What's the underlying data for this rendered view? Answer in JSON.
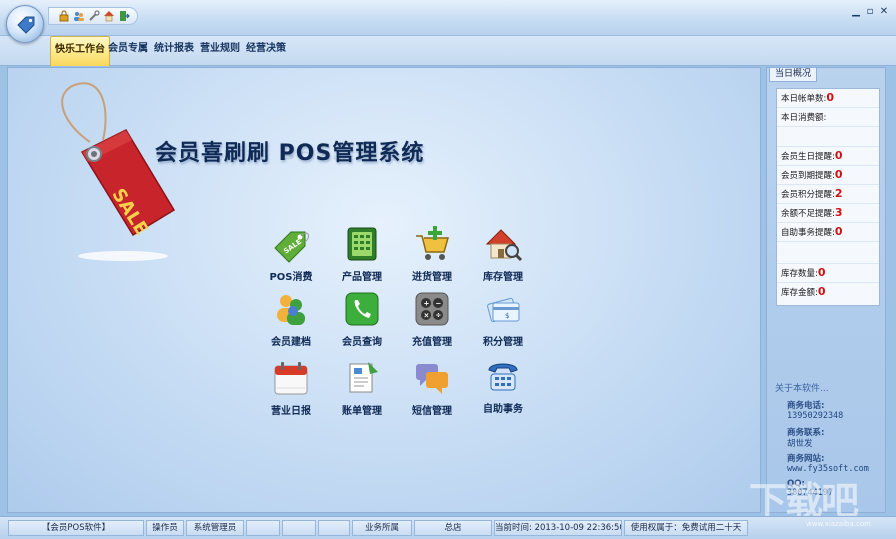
{
  "toolbar": {
    "quick_access": [
      "lock-icon",
      "users-icon",
      "tools-icon",
      "home-icon",
      "exit-icon"
    ],
    "window_controls": [
      "minimize",
      "restore",
      "close"
    ]
  },
  "tabs": [
    {
      "label": "快乐工作台",
      "active": true
    },
    {
      "label": "会员专属"
    },
    {
      "label": "统计报表"
    },
    {
      "label": "营业规则"
    },
    {
      "label": "经营决策"
    }
  ],
  "main": {
    "title": "会员喜刷刷 POS管理系统",
    "sale_tag_text": "SALE",
    "tiles": [
      {
        "label": "POS消费",
        "icon": "sale-tag-icon"
      },
      {
        "label": "产品管理",
        "icon": "calculator-icon"
      },
      {
        "label": "进货管理",
        "icon": "cart-icon"
      },
      {
        "label": "库存管理",
        "icon": "house-search-icon"
      },
      {
        "label": "会员建档",
        "icon": "members-icon"
      },
      {
        "label": "会员查询",
        "icon": "phone-icon"
      },
      {
        "label": "充值管理",
        "icon": "keypad-icon"
      },
      {
        "label": "积分管理",
        "icon": "card-icon"
      },
      {
        "label": "营业日报",
        "icon": "calendar-icon"
      },
      {
        "label": "账单管理",
        "icon": "document-icon"
      },
      {
        "label": "短信管理",
        "icon": "chat-icon"
      },
      {
        "label": "自助事务",
        "icon": "telephone-icon"
      }
    ]
  },
  "today": {
    "tab_label": "当日概况",
    "rows": [
      {
        "label": "本日帐单数:",
        "value": "0"
      },
      {
        "label": "本日消费额:",
        "value": ""
      },
      {
        "label": "",
        "value": ""
      },
      {
        "label": "会员生日提醒:",
        "value": "0"
      },
      {
        "label": "会员到期提醒:",
        "value": "0"
      },
      {
        "label": "会员积分提醒:",
        "value": "2"
      },
      {
        "label": "余额不足提醒:",
        "value": "3"
      },
      {
        "label": "自助事务提醒:",
        "value": "0"
      },
      {
        "label": "",
        "value": ""
      },
      {
        "label": "库存数量:",
        "value": "0"
      },
      {
        "label": "库存金额:",
        "value": "0"
      }
    ]
  },
  "about": {
    "heading": "关于本软件...",
    "phone_label": "商务电话:",
    "phone": "13950292348",
    "contact_label": "商务联系:",
    "contact": "胡世发",
    "site_label": "商务网站:",
    "site": "www.fy35soft.com",
    "qq_label": "QQ:",
    "qq": "380744197"
  },
  "watermark": {
    "text": "下载吧",
    "url": "www.xiazaiba.com"
  },
  "status": {
    "app": "【会员POS软件】",
    "operator_label": "操作员",
    "operator": "系统管理员",
    "business_label": "业务所属",
    "business": "总店",
    "time": "当前时间: 2013-10-09 22:36:50",
    "license": "使用权属于：免费试用二十天"
  },
  "colors": {
    "accent": "#f7d65c",
    "alert_value": "#d01010",
    "title": "#0f2a55"
  }
}
